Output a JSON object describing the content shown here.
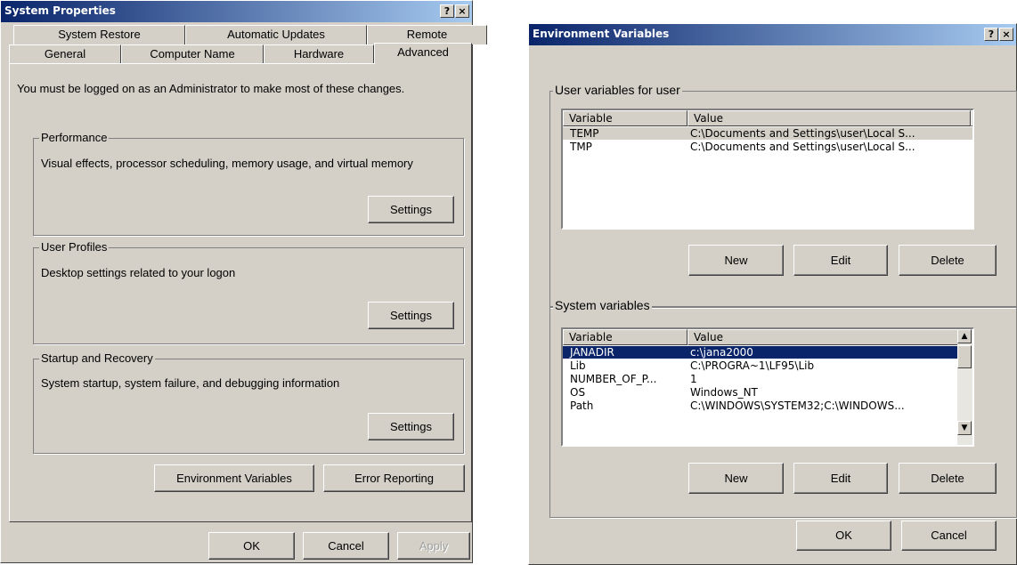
{
  "system_properties": {
    "title": "System Properties",
    "help_btn": "?",
    "close_btn": "×",
    "tabs_back": [
      "System Restore",
      "Automatic Updates",
      "Remote"
    ],
    "tabs_front": [
      "General",
      "Computer Name",
      "Hardware",
      "Advanced"
    ],
    "notice": "You must be logged on as an Administrator to make most of these changes.",
    "performance": {
      "legend": "Performance",
      "description": "Visual effects, processor scheduling, memory usage, and virtual memory",
      "button": "Settings"
    },
    "user_profiles": {
      "legend": "User Profiles",
      "description": "Desktop settings related to your logon",
      "button": "Settings"
    },
    "startup_recovery": {
      "legend": "Startup and Recovery",
      "description": "System startup, system failure, and debugging information",
      "button": "Settings"
    },
    "env_vars_button": "Environment Variables",
    "error_reporting_button": "Error Reporting",
    "ok": "OK",
    "cancel": "Cancel",
    "apply": "Apply"
  },
  "environment_variables": {
    "title": "Environment Variables",
    "help_btn": "?",
    "close_btn": "×",
    "user_group": {
      "legend": "User variables for user",
      "headers": [
        "Variable",
        "Value"
      ],
      "rows": [
        {
          "variable": "TEMP",
          "value": "C:\\Documents and Settings\\user\\Local S..."
        },
        {
          "variable": "TMP",
          "value": "C:\\Documents and Settings\\user\\Local S..."
        }
      ],
      "new": "New",
      "edit": "Edit",
      "delete": "Delete"
    },
    "system_group": {
      "legend": "System variables",
      "headers": [
        "Variable",
        "Value"
      ],
      "rows": [
        {
          "variable": "JANADIR",
          "value": "c:\\jana2000"
        },
        {
          "variable": "Lib",
          "value": "C:\\PROGRA~1\\LF95\\Lib"
        },
        {
          "variable": "NUMBER_OF_P...",
          "value": "1"
        },
        {
          "variable": "OS",
          "value": "Windows_NT"
        },
        {
          "variable": "Path",
          "value": "C:\\WINDOWS\\SYSTEM32;C:\\WINDOWS..."
        }
      ],
      "scroll_up": "▲",
      "scroll_down": "▼",
      "new": "New",
      "edit": "Edit",
      "delete": "Delete"
    },
    "ok": "OK",
    "cancel": "Cancel"
  }
}
